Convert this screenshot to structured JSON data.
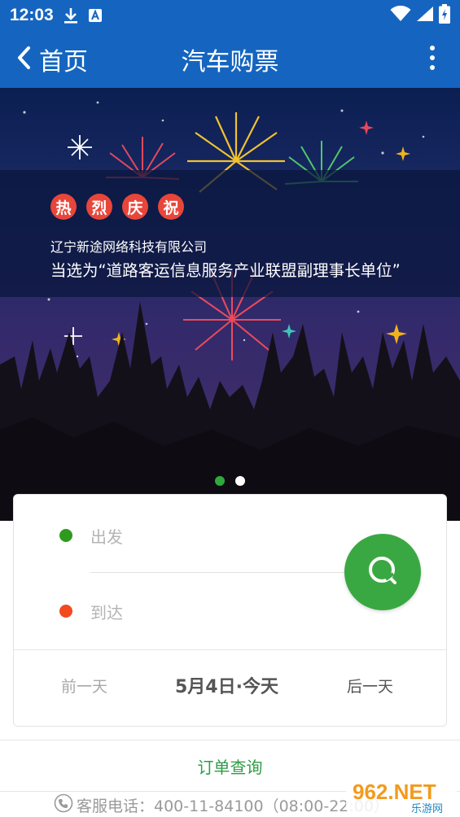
{
  "status_bar": {
    "time": "12:03",
    "icons": [
      "download-icon",
      "notification-a-icon",
      "wifi-icon",
      "signal-icon",
      "battery-charging-icon"
    ]
  },
  "app_bar": {
    "back_label": "首页",
    "title": "汽车购票",
    "menu_icon": "more-vertical-icon"
  },
  "banner": {
    "badges": [
      "热",
      "烈",
      "庆",
      "祝"
    ],
    "company": "辽宁新途网络科技有限公司",
    "headline": "当选为“道路客运信息服务产业联盟副理事长单位”",
    "slide_count": 2,
    "active_slide": 1
  },
  "booking": {
    "departure_placeholder": "出发",
    "arrival_placeholder": "到达",
    "search_icon": "search-icon",
    "prev_day": "前一天",
    "current_date": "5月4日·今天",
    "next_day": "后一天"
  },
  "order_query": {
    "label": "订单查询"
  },
  "service": {
    "text": "客服电话：400-11-84100（08:00-22:00）"
  },
  "watermark": {
    "text": "962.NET",
    "subtext": "乐游网"
  },
  "colors": {
    "primary_blue": "#1565c0",
    "green": "#3aa842",
    "departure_dot": "#2e9a1e",
    "arrival_dot": "#f24a1f",
    "badge_red": "#e8463a"
  }
}
